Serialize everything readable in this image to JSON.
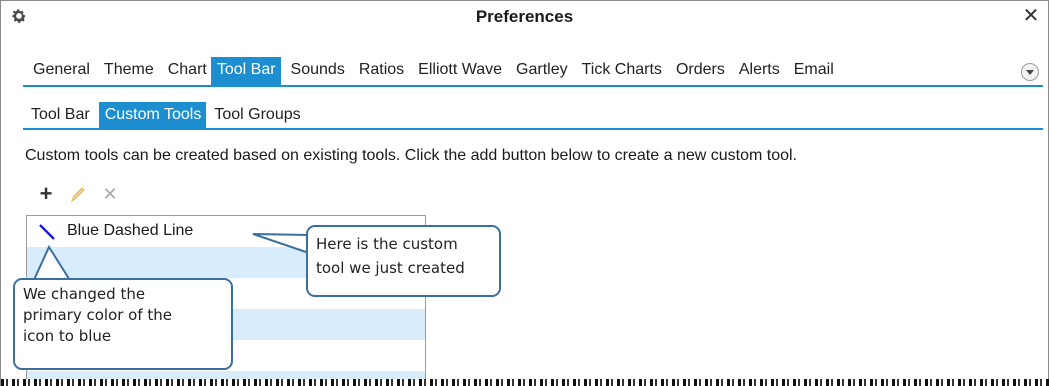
{
  "window": {
    "title": "Preferences",
    "settings_icon": "gear-icon",
    "close_label": "✕"
  },
  "main_tabs": [
    {
      "label": "General"
    },
    {
      "label": "Theme"
    },
    {
      "label": "Chart"
    },
    {
      "label": "Tool Bar",
      "active": true
    },
    {
      "label": "Sounds"
    },
    {
      "label": "Ratios"
    },
    {
      "label": "Elliott Wave"
    },
    {
      "label": "Gartley"
    },
    {
      "label": "Tick Charts"
    },
    {
      "label": "Orders"
    },
    {
      "label": "Alerts"
    },
    {
      "label": "Email"
    }
  ],
  "sub_tabs": [
    {
      "label": "Tool Bar"
    },
    {
      "label": "Custom Tools",
      "active": true
    },
    {
      "label": "Tool Groups"
    }
  ],
  "description": "Custom tools can be created based on existing tools.  Click the add button below to create a new custom tool.",
  "toolbar": {
    "add_icon": "plus-icon",
    "edit_icon": "pencil-icon",
    "delete_icon": "x-icon"
  },
  "custom_tools": [
    {
      "label": "Blue Dashed Line",
      "icon": "blue-line-icon",
      "icon_color": "#1a1ad6"
    }
  ],
  "callouts": {
    "custom_tool": "Here is the custom tool we just created",
    "custom_tool_lines": [
      "Here is the custom",
      "tool we just created"
    ],
    "icon_color": "We changed the primary color of the icon to blue",
    "icon_color_lines": [
      "We changed the",
      "primary color of the",
      "icon to blue"
    ]
  },
  "colors": {
    "accent": "#1d8fd1",
    "stripe": "#d9ecfb",
    "callout_border": "#3a6f9f"
  }
}
